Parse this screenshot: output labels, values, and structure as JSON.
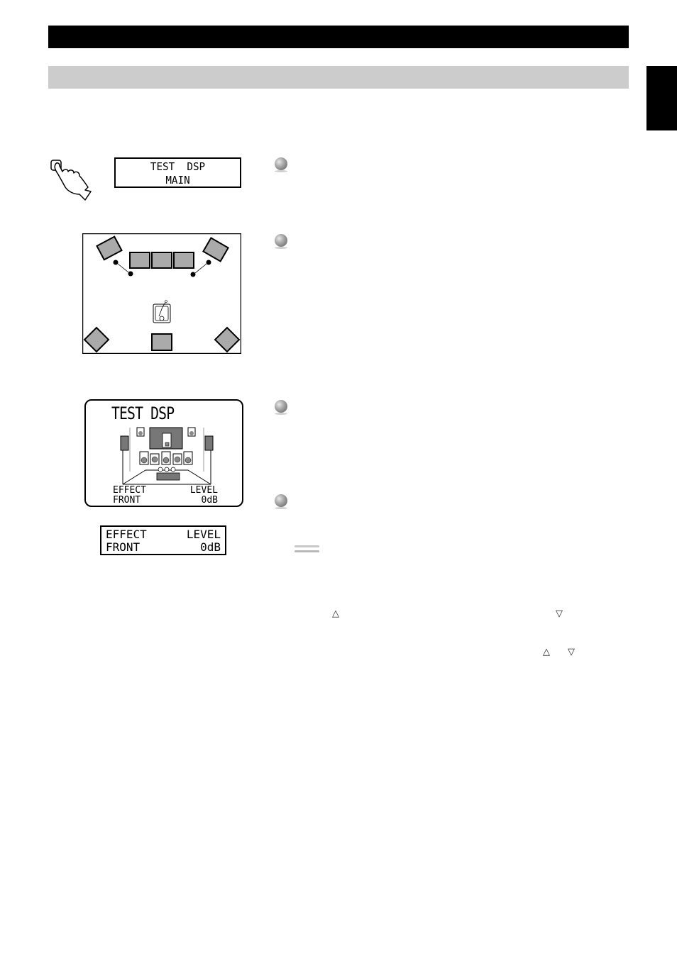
{
  "header": {
    "title_bar_color": "#000000",
    "subtitle_bar_color": "#cccccc",
    "side_tab_color": "#000000"
  },
  "step1": {
    "icon": "hand-press-button-icon",
    "lcd_line1": "TEST  DSP",
    "lcd_line2": "MAIN"
  },
  "room_diagram": {
    "icon": "listener-icon",
    "speakers": [
      "front-left-effect",
      "front-l",
      "center",
      "front-r",
      "front-right-effect",
      "rear-left",
      "subwoofer",
      "rear-right"
    ]
  },
  "osd_screen": {
    "title": "TEST DSP",
    "row1_left": "EFFECT",
    "row1_right": "LEVEL",
    "row2_left": "FRONT",
    "row2_right": "0dB"
  },
  "front_panel_display": {
    "row1_left": "EFFECT",
    "row1_right": "LEVEL",
    "row2_left": "FRONT",
    "row2_right": "0dB"
  },
  "bullets": [
    "step-bullet-1",
    "step-bullet-2",
    "step-bullet-3",
    "step-bullet-4"
  ],
  "symbols": {
    "up": "△",
    "down": "▽"
  }
}
